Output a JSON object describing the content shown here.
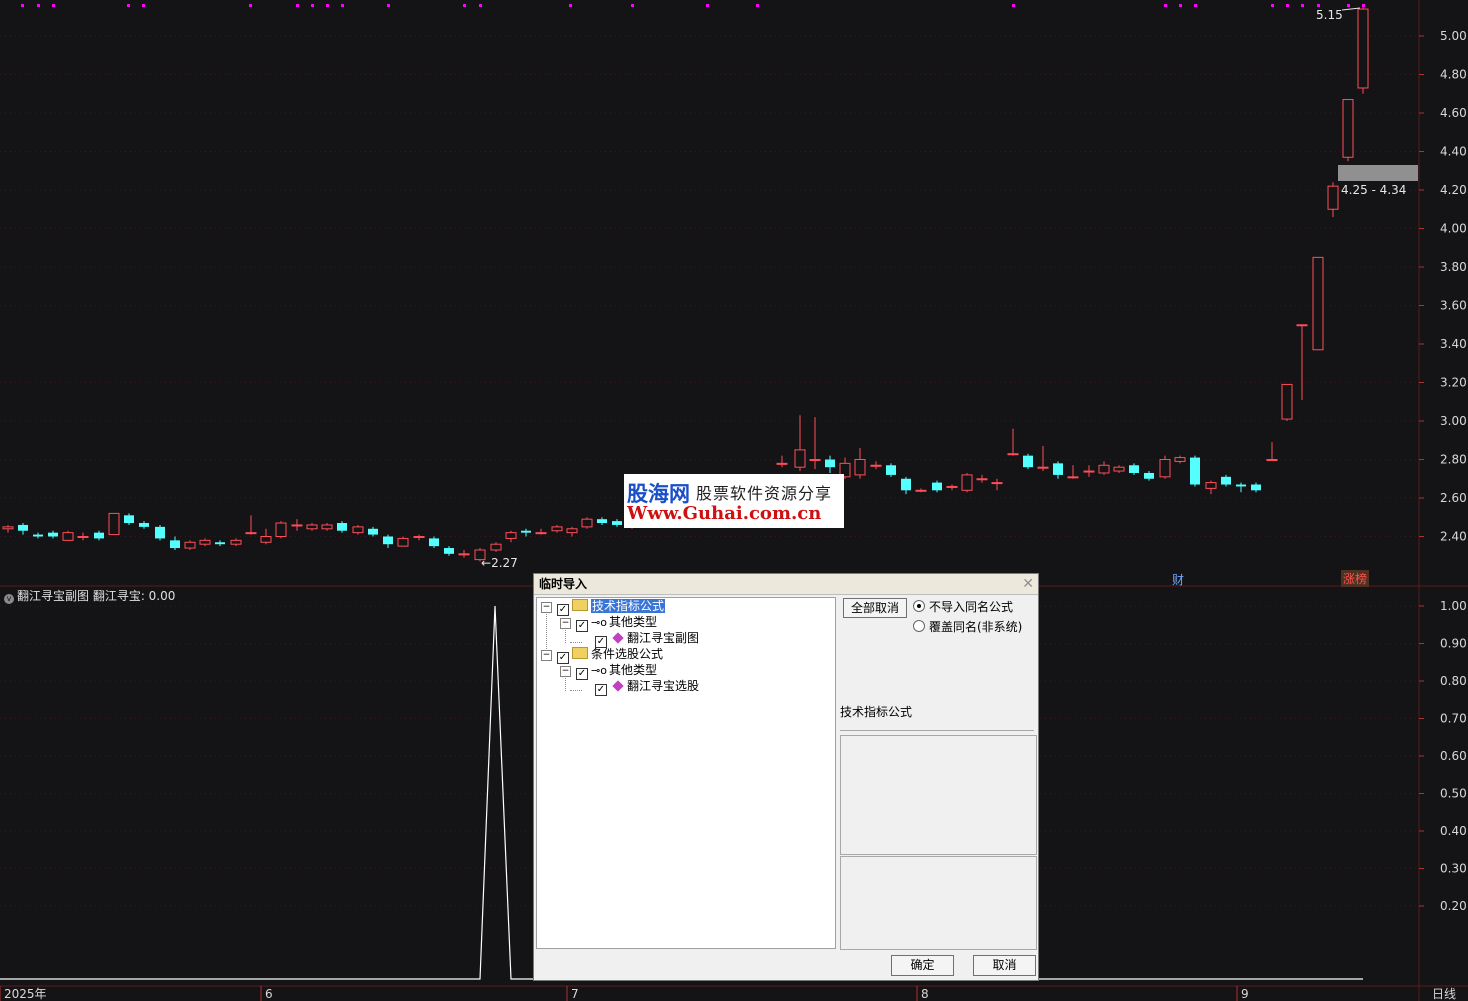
{
  "chart": {
    "price_labels": [
      "5.00",
      "4.80",
      "4.60",
      "4.40",
      "4.20",
      "4.00",
      "3.80",
      "3.60",
      "3.40",
      "3.20",
      "3.00",
      "2.80",
      "2.60",
      "2.40"
    ],
    "sub_labels": [
      "1.00",
      "0.90",
      "0.80",
      "0.70",
      "0.60",
      "0.50",
      "0.40",
      "0.30",
      "0.20"
    ],
    "date_labels": [
      "2025年",
      "6",
      "7",
      "8",
      "9"
    ],
    "period": "日线",
    "high_label": "5.15",
    "low_label": "2.27",
    "range_text": "4.25 - 4.34",
    "tag_cai": "财",
    "tag_zhangting": "涨榜",
    "sub_title": "翻江寻宝副图  翻江寻宝: 0.00",
    "colors": {
      "up": "#ff4d58",
      "down": "#54ffff",
      "bg": "#141416",
      "marker": "#ff00ff"
    }
  },
  "watermark": {
    "brand": "股海网",
    "slogan": "股票软件资源分享",
    "url": "Www.Guhai.com.cn"
  },
  "dialog": {
    "title": "临时导入",
    "close_icon": "close-icon",
    "tree": {
      "n1": "技术指标公式",
      "n1a": "其他类型",
      "n1a1": "翻江寻宝副图",
      "n2": "条件选股公式",
      "n2a": "其他类型",
      "n2a1": "翻江寻宝选股"
    },
    "uncheck_all": "全部取消",
    "radio1": "不导入同名公式",
    "radio2": "覆盖同名(非系统)",
    "category_label": "技术指标公式",
    "ok": "确定",
    "cancel": "取消"
  }
}
